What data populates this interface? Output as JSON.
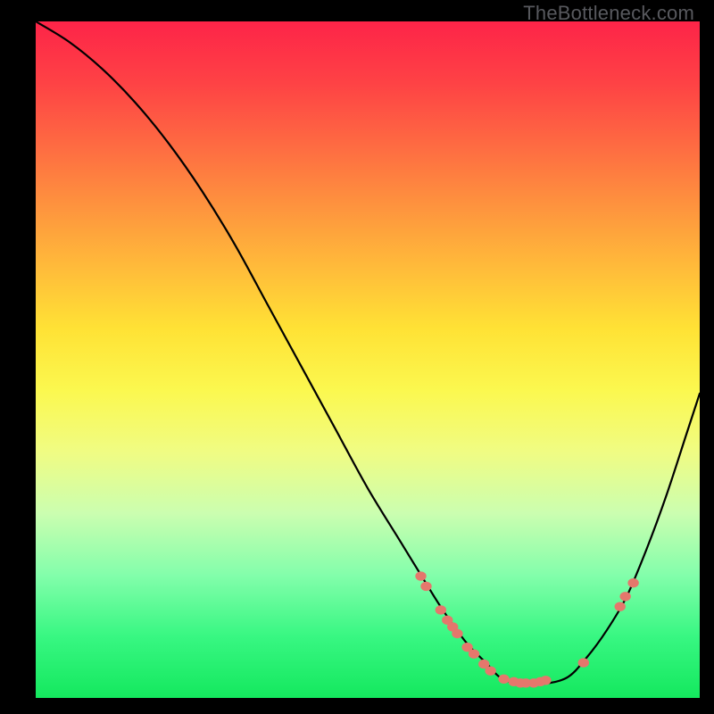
{
  "watermark": {
    "text": "TheBottleneck.com"
  },
  "colors": {
    "background": "#000000",
    "curve": "#000000",
    "marker": "#e5776c",
    "gradient_stops": [
      "#fd2448",
      "#fe4245",
      "#fe6a42",
      "#fe933e",
      "#ffbb3a",
      "#ffe235",
      "#fbf84f",
      "#f0fc83",
      "#cbfeb0",
      "#83feab",
      "#38f782",
      "#14e85e"
    ]
  },
  "chart_data": {
    "type": "line",
    "title": "",
    "xlabel": "",
    "ylabel": "",
    "xlim": [
      0,
      100
    ],
    "ylim": [
      0,
      100
    ],
    "curve": {
      "x": [
        0,
        5,
        10,
        15,
        20,
        25,
        30,
        35,
        40,
        45,
        50,
        55,
        60,
        62,
        65,
        68,
        70,
        73,
        76,
        80,
        83,
        86,
        89,
        92,
        95,
        98,
        100
      ],
      "y": [
        100,
        97,
        93,
        88,
        82,
        75,
        67,
        58,
        49,
        40,
        31,
        23,
        15,
        12,
        8,
        5,
        3,
        2,
        2,
        3,
        6,
        10,
        15,
        22,
        30,
        39,
        45
      ]
    },
    "markers": [
      {
        "x": 58.0,
        "y": 18.0
      },
      {
        "x": 58.8,
        "y": 16.5
      },
      {
        "x": 61.0,
        "y": 13.0
      },
      {
        "x": 62.0,
        "y": 11.5
      },
      {
        "x": 62.8,
        "y": 10.5
      },
      {
        "x": 63.5,
        "y": 9.5
      },
      {
        "x": 65.0,
        "y": 7.5
      },
      {
        "x": 66.0,
        "y": 6.5
      },
      {
        "x": 67.5,
        "y": 5.0
      },
      {
        "x": 68.5,
        "y": 4.0
      },
      {
        "x": 70.5,
        "y": 2.8
      },
      {
        "x": 72.0,
        "y": 2.4
      },
      {
        "x": 73.0,
        "y": 2.2
      },
      {
        "x": 73.8,
        "y": 2.2
      },
      {
        "x": 75.0,
        "y": 2.2
      },
      {
        "x": 76.0,
        "y": 2.4
      },
      {
        "x": 76.8,
        "y": 2.6
      },
      {
        "x": 82.5,
        "y": 5.2
      },
      {
        "x": 88.0,
        "y": 13.5
      },
      {
        "x": 88.8,
        "y": 15.0
      },
      {
        "x": 90.0,
        "y": 17.0
      }
    ]
  }
}
